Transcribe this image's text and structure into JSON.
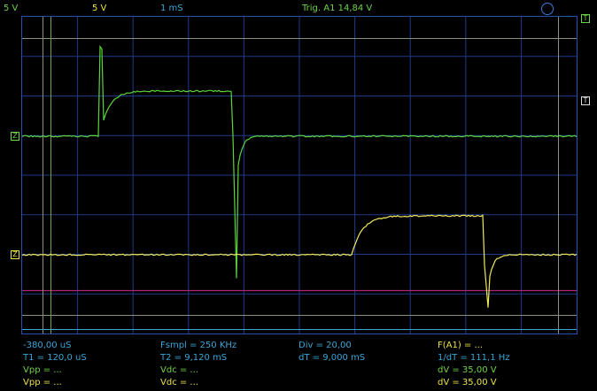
{
  "header": {
    "ch1_volts_div": "5 V",
    "ch2_volts_div": "5 V",
    "time_div": "1 mS",
    "trigger_text": "Trig. A1  14,84 V"
  },
  "markers": {
    "ground_symbol": "Z",
    "trigger_symbol": "T"
  },
  "readouts": {
    "col1": {
      "offset": "-380,00 uS",
      "t1": "T1 = 120,0 uS",
      "vpp1": "Vpp = ...",
      "vpp2": "Vpp = ..."
    },
    "col2": {
      "fsmpl": "Fsmpl = 250 KHz",
      "t2": "T2 = 9,120 mS",
      "vdc1": "Vdc = ...",
      "vdc2": "Vdc = ..."
    },
    "col3": {
      "div": "Div = 20,00",
      "dt": "dT = 9,000 mS"
    },
    "col4": {
      "fa1": "F(A1) = ...",
      "inv_dt": "1/dT = 111,1 Hz",
      "dv1": "dV = 35,00 V",
      "dv2": "dV = 35,00 V"
    }
  },
  "colors": {
    "grid": "#1e3a8c",
    "ch1": "#5cd63a",
    "ch2": "#f0ea5a",
    "ref": "#b0247a",
    "cursor": "#8a8a7a"
  }
}
